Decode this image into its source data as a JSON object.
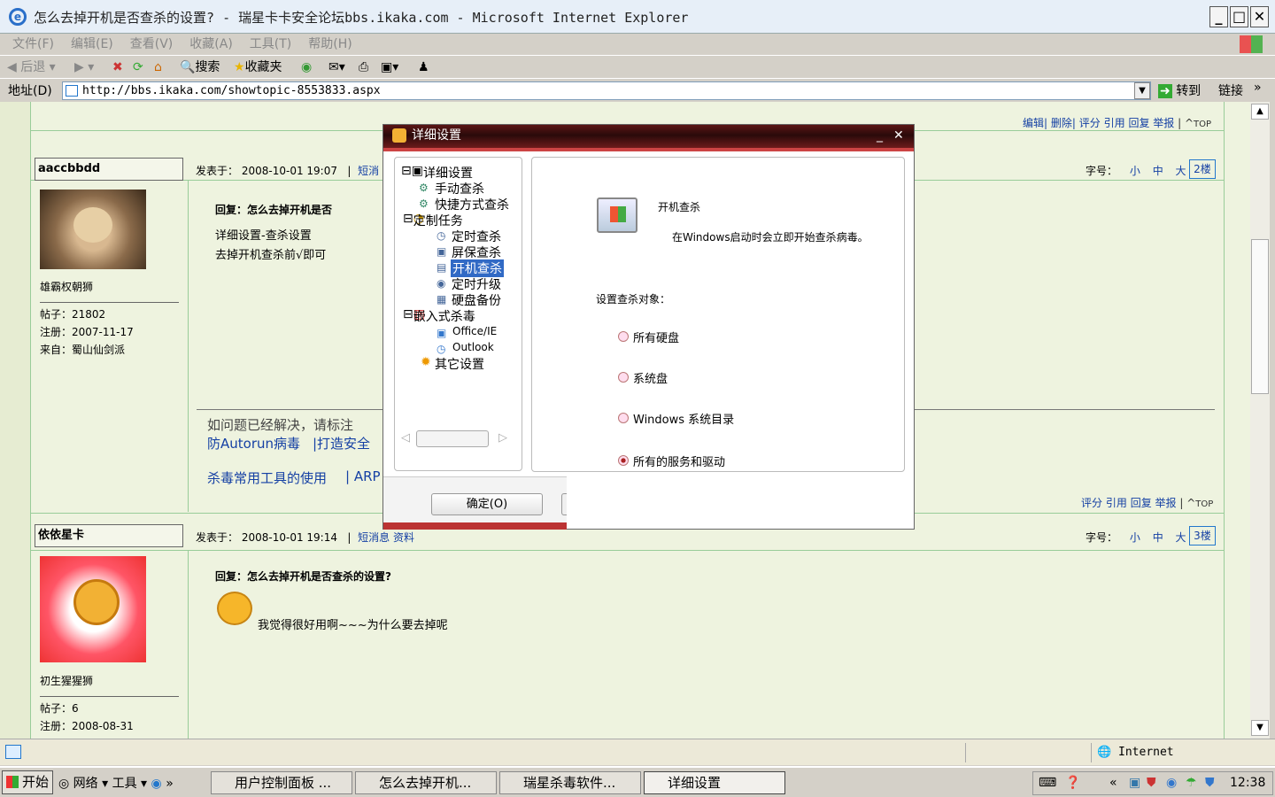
{
  "window": {
    "title": "怎么去掉开机是否查杀的设置? - 瑞星卡卡安全论坛bbs.ikaka.com - Microsoft Internet Explorer"
  },
  "menu": [
    "文件(F)",
    "编辑(E)",
    "查看(V)",
    "收藏(A)",
    "工具(T)",
    "帮助(H)"
  ],
  "toolbar": {
    "back": "后退",
    "search": "搜索",
    "favorites": "收藏夹"
  },
  "address": {
    "label": "地址(D)",
    "url": "http://bbs.ikaka.com/showtopic-8553833.aspx",
    "go": "转到",
    "links": "链接"
  },
  "forum": {
    "top_actions": [
      "编辑",
      "删除",
      "评分",
      "引用",
      "回复",
      "举报",
      "TOP"
    ],
    "post1": {
      "username": "aaccbbdd",
      "posted_label": "发表于：",
      "time": "2008-10-01 19:07",
      "pm": "短消",
      "font_label": "字号：",
      "sizes": [
        "小",
        "中",
        "大"
      ],
      "floor": "2楼",
      "rank": "雄霸权朝狮",
      "posts": "帖子：21802",
      "reg": "注册：2007-11-17",
      "from": "来自：蜀山仙剑派",
      "title": "回复：怎么去掉开机是否",
      "line1": "详细设置-查杀设置",
      "line2": "去掉开机查杀前√即可",
      "sig1": "如问题已经解决，请标注",
      "sig2": "防Autorun病毒",
      "sig3": "|打造安全",
      "sig4": "杀毒常用工具的使用",
      "sig5": "| ARP",
      "actions": [
        "评分",
        "引用",
        "回复",
        "举报",
        "TOP"
      ]
    },
    "post2": {
      "username": "依依星卡",
      "posted_label": "发表于：",
      "time": "2008-10-01 19:14",
      "pm": "短消息",
      "profile": "资料",
      "font_label": "字号：",
      "sizes": [
        "小",
        "中",
        "大"
      ],
      "floor": "3楼",
      "rank": "初生猩猩狮",
      "posts": "帖子：6",
      "reg": "注册：2008-08-31",
      "title": "回复：怎么去掉开机是否查杀的设置?",
      "body": "我觉得很好用啊~~~为什么要去掉呢"
    }
  },
  "dialog": {
    "title": "详细设置",
    "tree": [
      "详细设置",
      "手动查杀",
      "快捷方式查杀",
      "定制任务",
      "定时查杀",
      "屏保查杀",
      "开机查杀",
      "定时升级",
      "硬盘备份",
      "嵌入式杀毒",
      "Office/IE",
      "Outlook",
      "其它设置"
    ],
    "panel_title": "开机查杀",
    "panel_desc": "在Windows启动时会立即开始查杀病毒。",
    "targets_label": "设置查杀对象：",
    "options": [
      "所有硬盘",
      "系统盘",
      "Windows 系统目录",
      "所有的服务和驱动"
    ],
    "selected_option": "所有的服务和驱动",
    "ok": "确定(O)"
  },
  "status": {
    "zone": "Internet"
  },
  "taskbar": {
    "start": "开始",
    "quick": [
      "网络",
      "工具"
    ],
    "tasks": [
      "用户控制面板 ...",
      "怎么去掉开机...",
      "瑞星杀毒软件...",
      "详细设置"
    ],
    "clock": "12:38"
  }
}
